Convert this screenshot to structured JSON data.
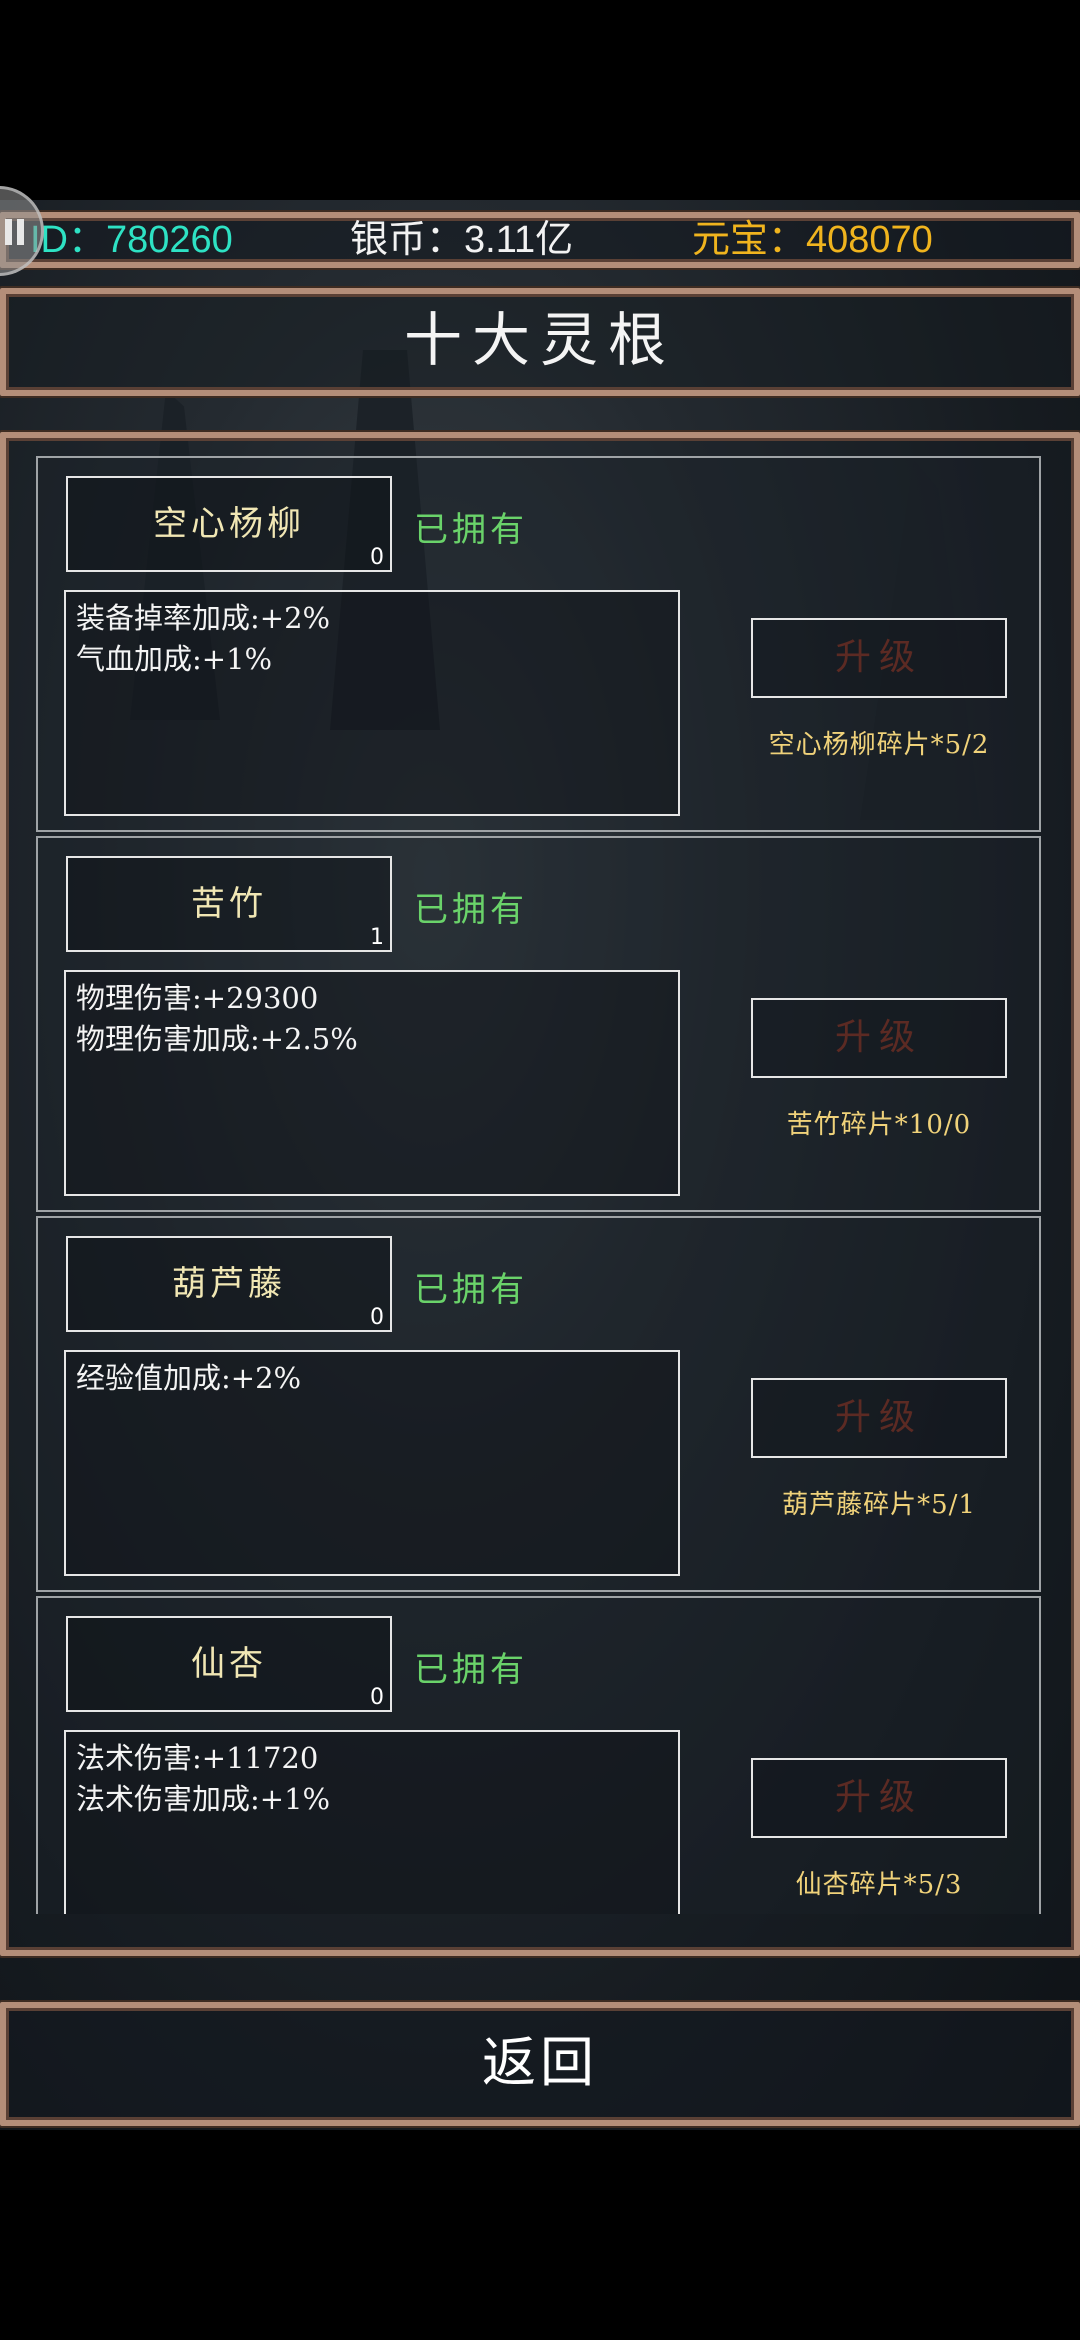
{
  "header": {
    "id_label": "ID：780260",
    "silver_label": "银币：3.11亿",
    "gold_label": "元宝：408070"
  },
  "title": "十大灵根",
  "roots": [
    {
      "name": "空心杨柳",
      "count": "0",
      "status": "已拥有",
      "attrs": [
        "装备掉率加成:+2%",
        "气血加成:+1%"
      ],
      "upgrade_label": "升级",
      "fragments": "空心杨柳碎片*5/2"
    },
    {
      "name": "苦竹",
      "count": "1",
      "status": "已拥有",
      "attrs": [
        "物理伤害:+29300",
        "物理伤害加成:+2.5%"
      ],
      "upgrade_label": "升级",
      "fragments": "苦竹碎片*10/0"
    },
    {
      "name": "葫芦藤",
      "count": "0",
      "status": "已拥有",
      "attrs": [
        "经验值加成:+2%"
      ],
      "upgrade_label": "升级",
      "fragments": "葫芦藤碎片*5/1"
    },
    {
      "name": "仙杏",
      "count": "0",
      "status": "已拥有",
      "attrs": [
        "法术伤害:+11720",
        "法术伤害加成:+1%"
      ],
      "upgrade_label": "升级",
      "fragments": "仙杏碎片*5/3"
    }
  ],
  "back_label": "返回",
  "colors": {
    "frame": "#b48e79",
    "id_text": "#2ee2c4",
    "gold_text": "#f0b41e",
    "owned_text": "#6ad36a",
    "name_text": "#f1e7b4",
    "fragment_text": "#f0d27a",
    "upgrade_disabled_text": "#5c2a23"
  }
}
